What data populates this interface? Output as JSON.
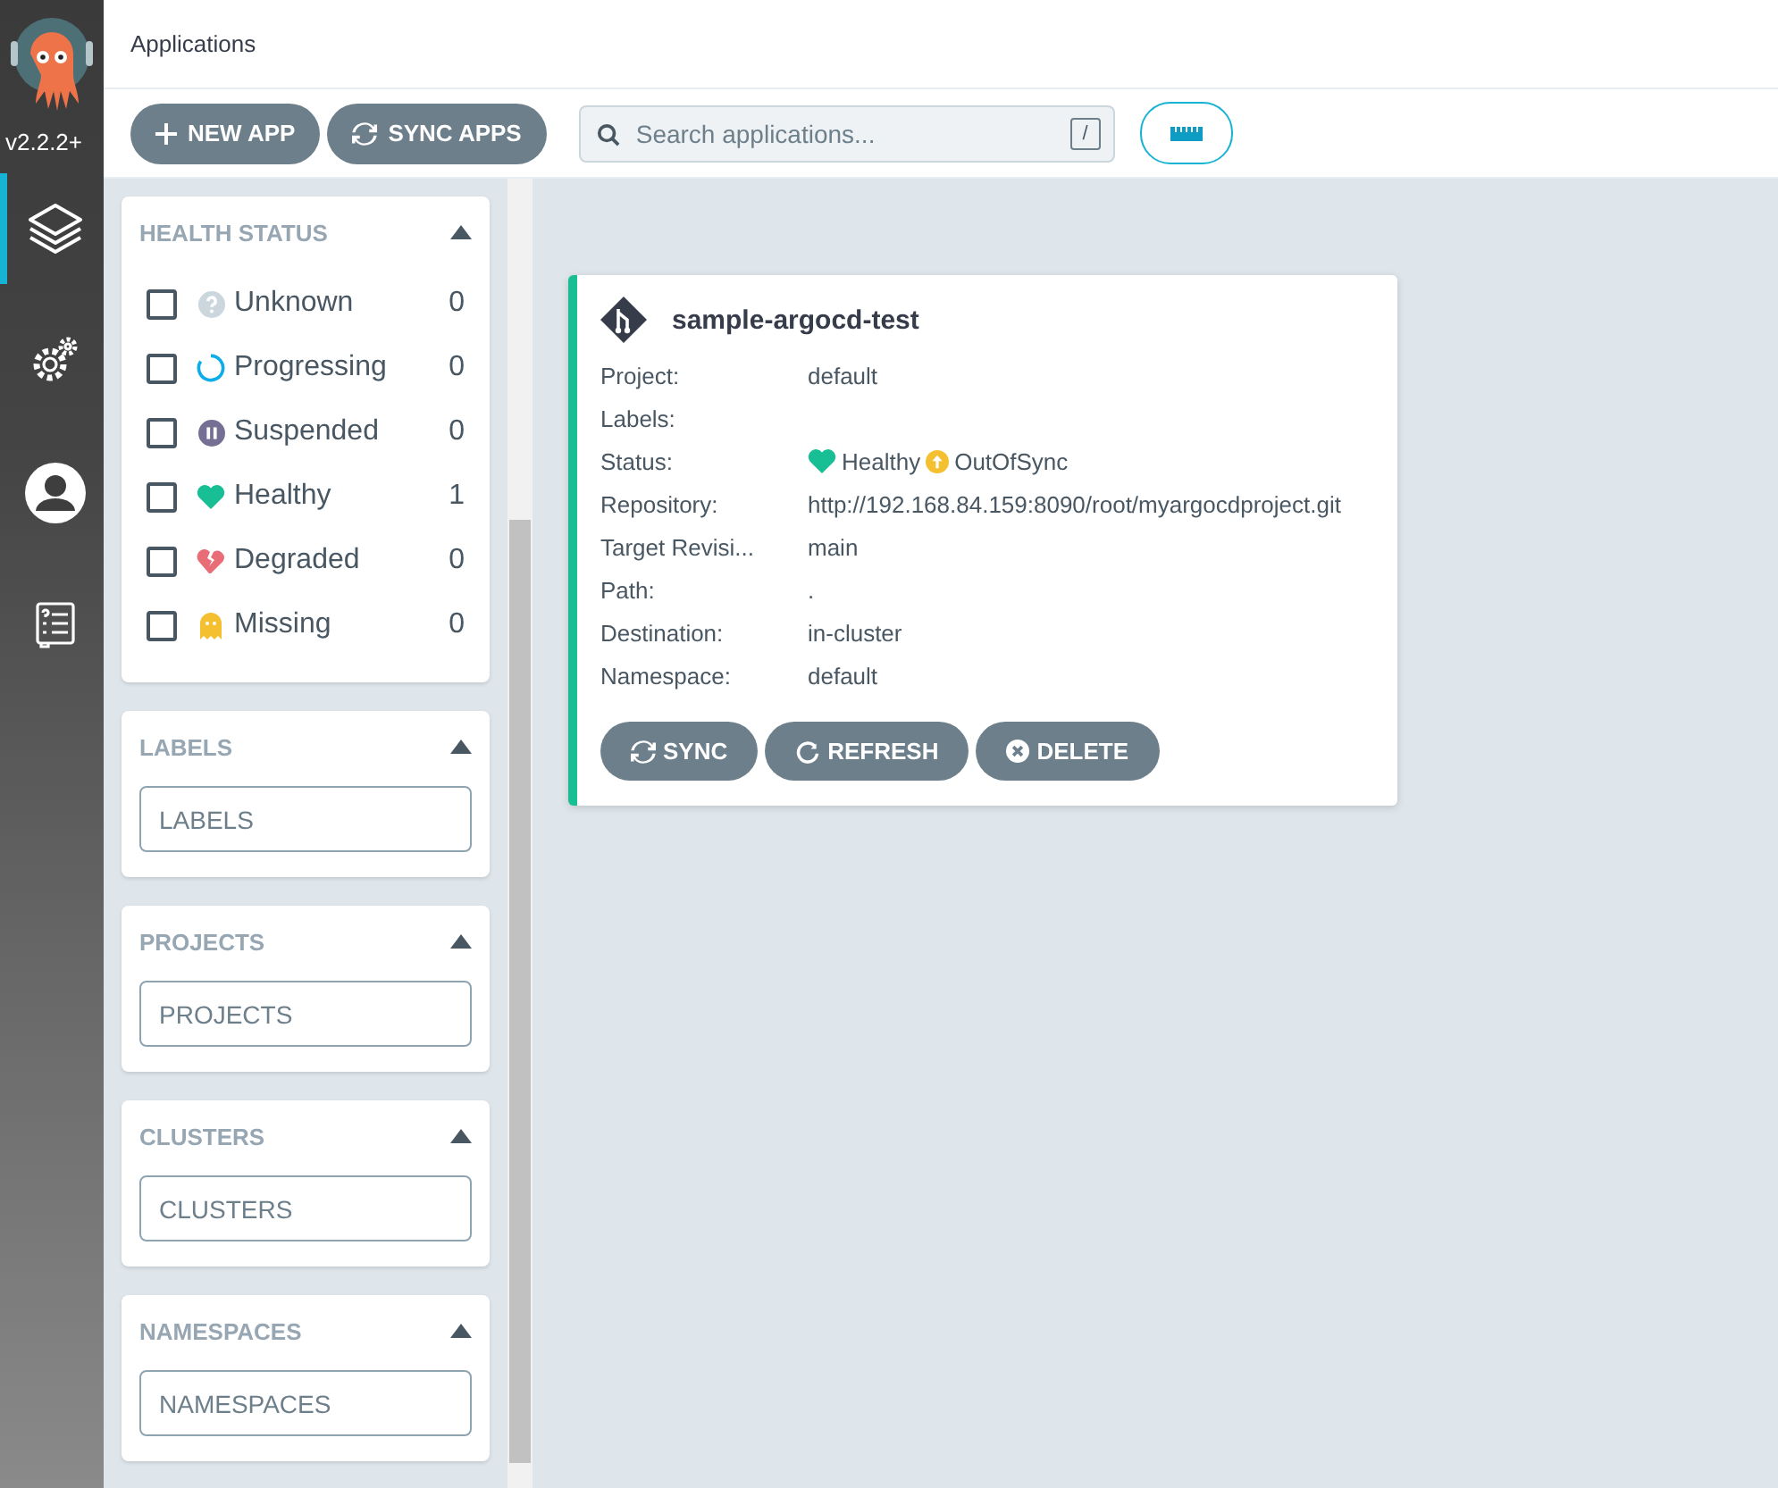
{
  "nav": {
    "version": "v2.2.2+",
    "items": [
      {
        "kind": "applications",
        "selected": true
      },
      {
        "kind": "settings",
        "selected": false
      },
      {
        "kind": "user",
        "selected": false
      },
      {
        "kind": "docs",
        "selected": false
      }
    ]
  },
  "header": {
    "title": "Applications"
  },
  "toolbar": {
    "buttons": [
      {
        "kind": "plus",
        "label": "NEW APP"
      },
      {
        "kind": "sync",
        "label": "SYNC APPS"
      }
    ],
    "search": {
      "placeholder": "Search applications...",
      "shortcut": "/"
    }
  },
  "filters": [
    {
      "kind": "checklist",
      "title": "HEALTH STATUS",
      "expanded": true,
      "items": [
        {
          "kind": "unknown",
          "label": "Unknown",
          "count": "0",
          "checked": false
        },
        {
          "kind": "progressing",
          "label": "Progressing",
          "count": "0",
          "checked": false
        },
        {
          "kind": "suspended",
          "label": "Suspended",
          "count": "0",
          "checked": false
        },
        {
          "kind": "healthy",
          "label": "Healthy",
          "count": "1",
          "checked": false
        },
        {
          "kind": "degraded",
          "label": "Degraded",
          "count": "0",
          "checked": false
        },
        {
          "kind": "missing",
          "label": "Missing",
          "count": "0",
          "checked": false
        }
      ]
    },
    {
      "kind": "input",
      "title": "LABELS",
      "expanded": true,
      "placeholder": "LABELS"
    },
    {
      "kind": "input",
      "title": "PROJECTS",
      "expanded": true,
      "placeholder": "PROJECTS"
    },
    {
      "kind": "input",
      "title": "CLUSTERS",
      "expanded": true,
      "placeholder": "CLUSTERS"
    },
    {
      "kind": "input",
      "title": "NAMESPACES",
      "expanded": true,
      "placeholder": "NAMESPACES"
    }
  ],
  "applications": [
    {
      "name": "sample-argocd-test",
      "fields": [
        {
          "label": "Project:",
          "value": "default"
        },
        {
          "label": "Labels:"
        },
        {
          "label": "Status:",
          "kind": "status",
          "health": {
            "kind": "healthy",
            "label": "Healthy"
          },
          "sync": {
            "kind": "outofsync",
            "label": "OutOfSync"
          }
        },
        {
          "label": "Repository:",
          "value": "http://192.168.84.159:8090/root/myargocdproject.git"
        },
        {
          "label": "Target Revisi...",
          "value": "main"
        },
        {
          "label": "Path:",
          "value": "."
        },
        {
          "label": "Destination:",
          "value": "in-cluster"
        },
        {
          "label": "Namespace:",
          "value": "default"
        }
      ],
      "buttons": [
        {
          "kind": "sync",
          "label": "SYNC"
        },
        {
          "kind": "refresh",
          "label": "REFRESH"
        },
        {
          "kind": "delete",
          "label": "DELETE"
        }
      ]
    }
  ]
}
